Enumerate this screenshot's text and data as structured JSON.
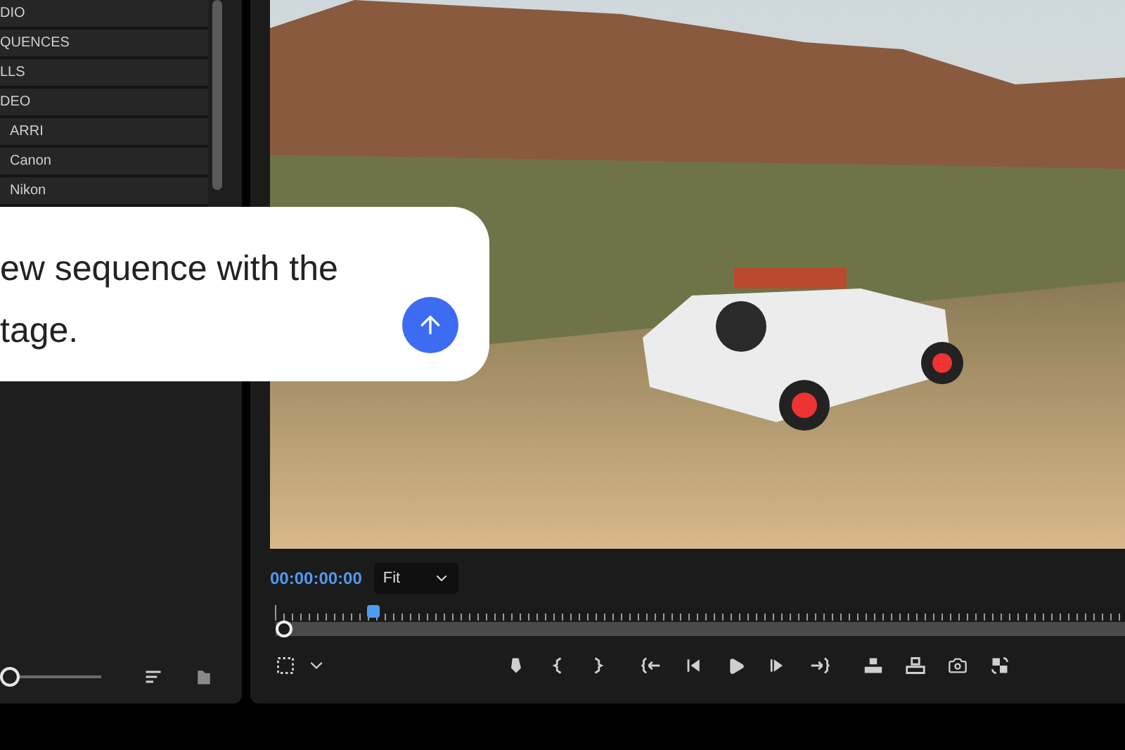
{
  "project_panel": {
    "bins": [
      {
        "label": "DIO"
      },
      {
        "label": "QUENCES"
      },
      {
        "label": "LLS"
      },
      {
        "label": "DEO",
        "children": [
          {
            "label": "ARRI"
          },
          {
            "label": "Canon"
          },
          {
            "label": "Nikon"
          }
        ]
      }
    ],
    "zoom_slider": {
      "level": 0
    }
  },
  "prompt_bubble": {
    "lines": [
      "ew sequence with the",
      "tage."
    ]
  },
  "program_monitor": {
    "timecode": "00:00:00:00",
    "zoom_select": {
      "value": "Fit"
    },
    "playhead": {
      "level": 0.12
    },
    "scrub_bar": {
      "level": 0.01
    }
  }
}
